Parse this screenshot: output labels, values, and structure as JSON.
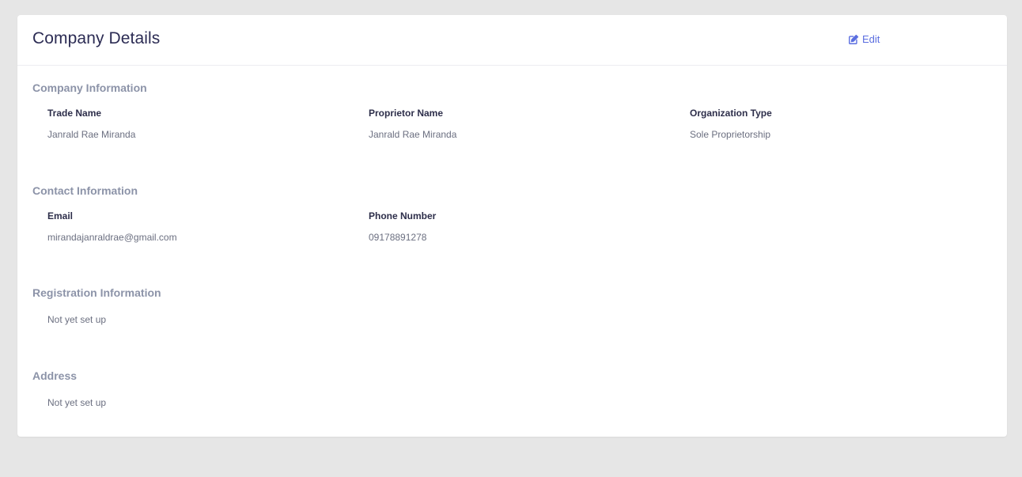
{
  "header": {
    "title": "Company Details",
    "edit_label": "Edit",
    "edit_icon": "edit-icon"
  },
  "company_information": {
    "title": "Company Information",
    "fields": [
      {
        "label": "Trade Name",
        "value": "Janrald Rae Miranda"
      },
      {
        "label": "Proprietor Name",
        "value": "Janrald Rae Miranda"
      },
      {
        "label": "Organization Type",
        "value": "Sole Proprietorship"
      }
    ]
  },
  "contact_information": {
    "title": "Contact Information",
    "fields": [
      {
        "label": "Email",
        "value": "mirandajanraldrae@gmail.com"
      },
      {
        "label": "Phone Number",
        "value": "09178891278"
      }
    ]
  },
  "registration_information": {
    "title": "Registration Information",
    "empty_text": "Not yet set up"
  },
  "address": {
    "title": "Address",
    "empty_text": "Not yet set up"
  },
  "colors": {
    "accent": "#5b6ee0",
    "title": "#2c2c54",
    "section_title": "#8c93a8",
    "background": "#e6e6e6"
  }
}
